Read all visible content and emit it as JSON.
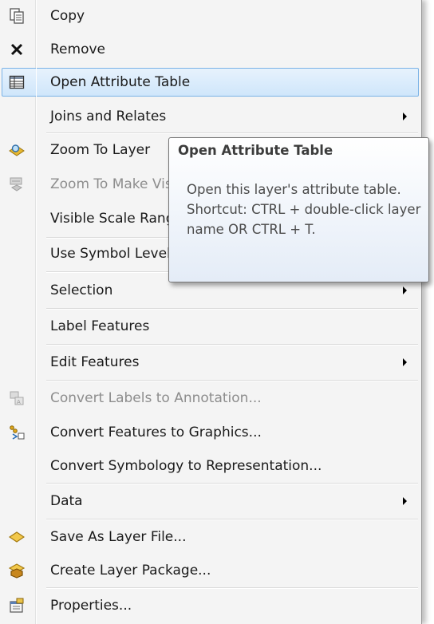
{
  "menu": {
    "items": [
      {
        "label": "Copy"
      },
      {
        "label": "Remove"
      },
      {
        "label": "Open Attribute Table"
      },
      {
        "label": "Joins and Relates"
      },
      {
        "label": "Zoom To Layer"
      },
      {
        "label": "Zoom To Make Visible"
      },
      {
        "label": "Visible Scale Range"
      },
      {
        "label": "Use Symbol Levels"
      },
      {
        "label": "Selection"
      },
      {
        "label": "Label Features"
      },
      {
        "label": "Edit Features"
      },
      {
        "label": "Convert Labels to Annotation..."
      },
      {
        "label": "Convert Features to Graphics..."
      },
      {
        "label": "Convert Symbology to Representation..."
      },
      {
        "label": "Data"
      },
      {
        "label": "Save As Layer File..."
      },
      {
        "label": "Create Layer Package..."
      },
      {
        "label": "Properties..."
      }
    ],
    "highlighted_item": "Open Attribute Table",
    "disabled_items": [
      "Zoom To Make Visible",
      "Convert Labels to Annotation..."
    ]
  },
  "tooltip": {
    "title": "Open Attribute Table",
    "body": "Open this layer's attribute table. Shortcut: CTRL + double-click layer name OR CTRL + T."
  },
  "colors": {
    "highlight_border": "#7ab2e6",
    "highlight_fill": "#d8ebfc",
    "disabled_text": "#8d8d8d"
  }
}
